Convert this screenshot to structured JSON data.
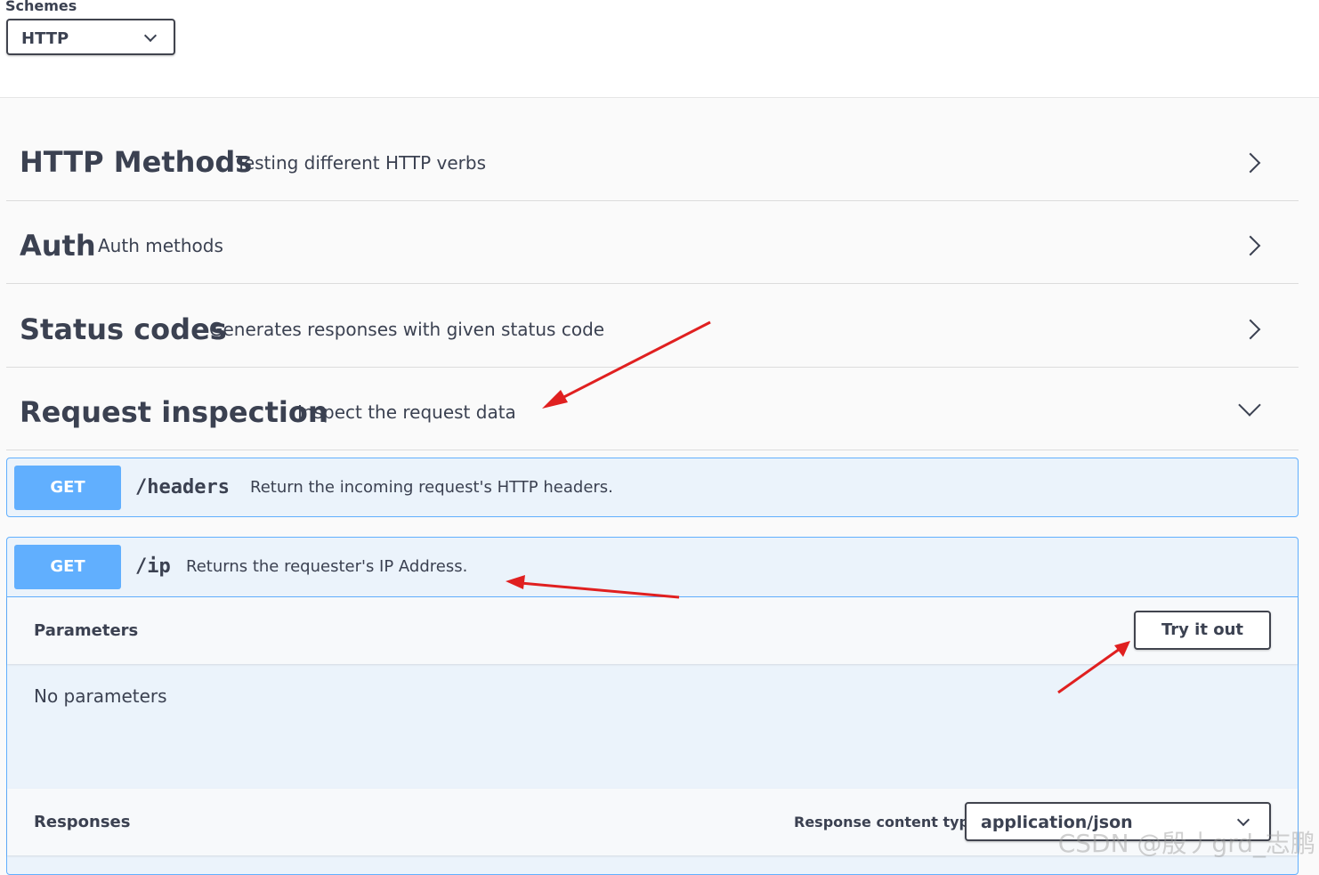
{
  "schemes": {
    "label": "Schemes",
    "selected": "HTTP"
  },
  "tags": [
    {
      "name": "HTTP Methods",
      "description": "Testing different HTTP verbs",
      "expanded": false
    },
    {
      "name": "Auth",
      "description": "Auth methods",
      "expanded": false
    },
    {
      "name": "Status codes",
      "description": "Generates responses with given status code",
      "expanded": false
    },
    {
      "name": "Request inspection",
      "description": "Inspect the request data",
      "expanded": true
    }
  ],
  "operations": [
    {
      "method": "GET",
      "path": "/headers",
      "summary": "Return the incoming request's HTTP headers."
    },
    {
      "method": "GET",
      "path": "/ip",
      "summary": "Returns the requester's IP Address."
    }
  ],
  "ip_operation": {
    "parameters_title": "Parameters",
    "try_it_out": "Try it out",
    "no_parameters": "No parameters",
    "responses_title": "Responses",
    "response_content_type_label": "Response content type",
    "response_content_type": "application/json"
  },
  "colors": {
    "get": "#61affe",
    "annotation": "#e02020"
  },
  "watermark": "CSDN @殷丿grd_志鹏"
}
